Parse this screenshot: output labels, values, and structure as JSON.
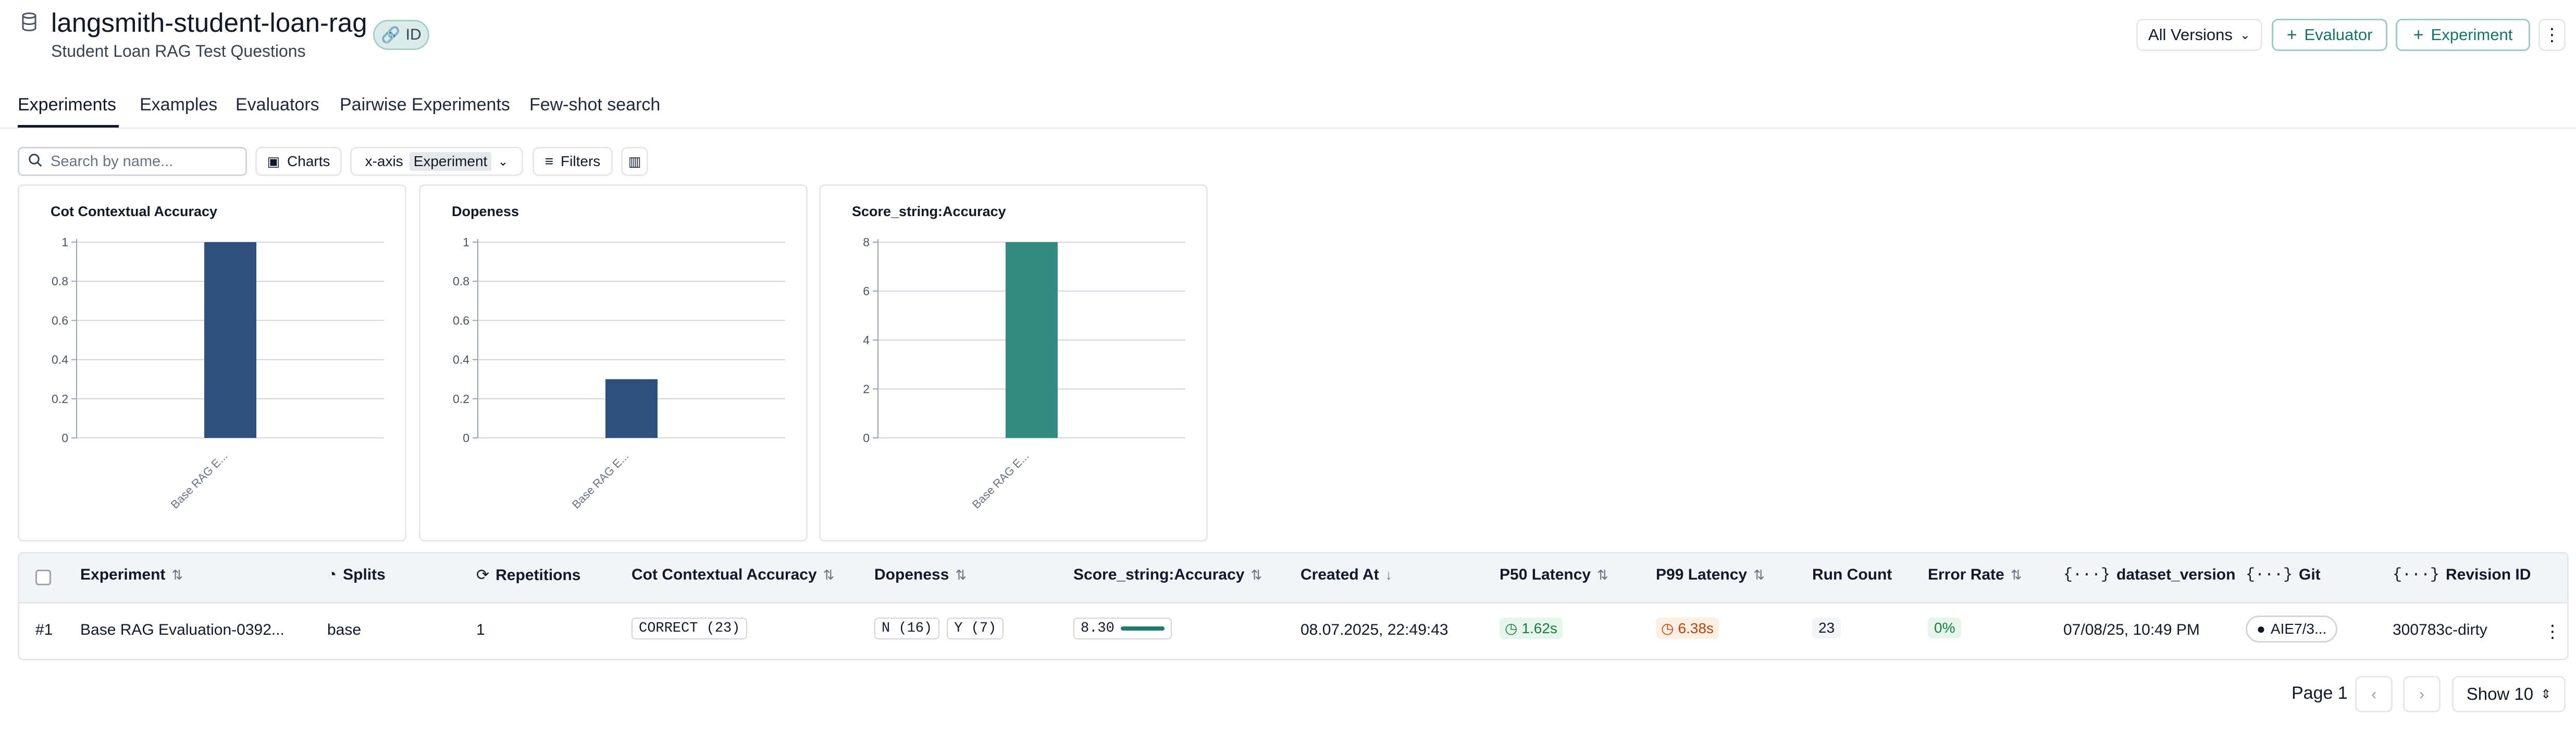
{
  "header": {
    "title": "langsmith-student-loan-rag",
    "subtitle": "Student Loan RAG Test Questions",
    "id_badge": "ID",
    "versions": "All Versions",
    "evaluator_btn": "Evaluator",
    "experiment_btn": "Experiment"
  },
  "tabs": [
    "Experiments",
    "Examples",
    "Evaluators",
    "Pairwise Experiments",
    "Few-shot search"
  ],
  "toolbar": {
    "search_placeholder": "Search by name...",
    "charts": "Charts",
    "xaxis_label": "x-axis",
    "xaxis_value": "Experiment",
    "filters": "Filters"
  },
  "chart_data": [
    {
      "type": "bar",
      "title": "Cot Contextual Accuracy",
      "categories": [
        "Base RAG E..."
      ],
      "values": [
        1
      ],
      "ylim": [
        0,
        1
      ],
      "yticks": [
        "0",
        "0.2",
        "0.4",
        "0.6",
        "0.8",
        "1"
      ],
      "color": "#2f4f7f"
    },
    {
      "type": "bar",
      "title": "Dopeness",
      "categories": [
        "Base RAG E..."
      ],
      "values": [
        0.3
      ],
      "ylim": [
        0,
        1
      ],
      "yticks": [
        "0",
        "0.2",
        "0.4",
        "0.6",
        "0.8",
        "1"
      ],
      "color": "#2f4f7f"
    },
    {
      "type": "bar",
      "title": "Score_string:Accuracy",
      "categories": [
        "Base RAG E..."
      ],
      "values": [
        8.3
      ],
      "ylim": [
        0,
        8
      ],
      "yticks": [
        "0",
        "2",
        "4",
        "6",
        "8"
      ],
      "color": "#338a80"
    }
  ],
  "table": {
    "headers": {
      "experiment": "Experiment",
      "splits": "Splits",
      "repetitions": "Repetitions",
      "cot": "Cot Contextual Accuracy",
      "dopeness": "Dopeness",
      "score": "Score_string:Accuracy",
      "created": "Created At",
      "p50": "P50 Latency",
      "p99": "P99 Latency",
      "runcount": "Run Count",
      "error": "Error Rate",
      "dataset_version": "dataset_version",
      "git": "Git",
      "revision": "Revision ID"
    },
    "row": {
      "index": "#1",
      "experiment": "Base RAG Evaluation-0392...",
      "splits": "base",
      "repetitions": "1",
      "cot": "CORRECT (23)",
      "dopeness_n": "N (16)",
      "dopeness_y": "Y (7)",
      "score": "8.30",
      "created": "08.07.2025, 22:49:43",
      "p50": "1.62s",
      "p99": "6.38s",
      "runcount": "23",
      "error": "0%",
      "dataset_version": "07/08/25, 10:49 PM",
      "git": "AIE7/3...",
      "revision": "300783c-dirty"
    }
  },
  "pagination": {
    "page": "Page 1",
    "show": "Show 10"
  }
}
